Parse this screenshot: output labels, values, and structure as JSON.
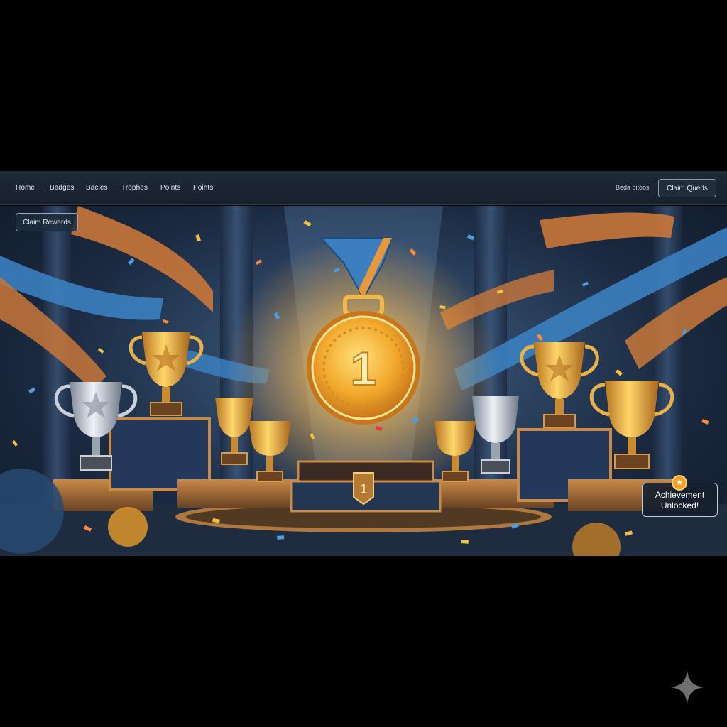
{
  "nav": {
    "items": [
      "Home",
      "Badges",
      "Bacles",
      "Trophes",
      "Points",
      "Points"
    ],
    "right_text": "Beda bitoos",
    "action_label": "Claim Queds"
  },
  "scene": {
    "claim_label": "Claim Rewards",
    "medal_rank": "1",
    "podium_rank": "1",
    "toast_line1": "Achievement",
    "toast_line2": "Unlocked!",
    "toast_icon": "star-icon"
  },
  "colors": {
    "gold": "#f3b33a",
    "ribbon_blue": "#3b7fc0",
    "ribbon_orange": "#c9773a",
    "background": "#1b2a41"
  }
}
